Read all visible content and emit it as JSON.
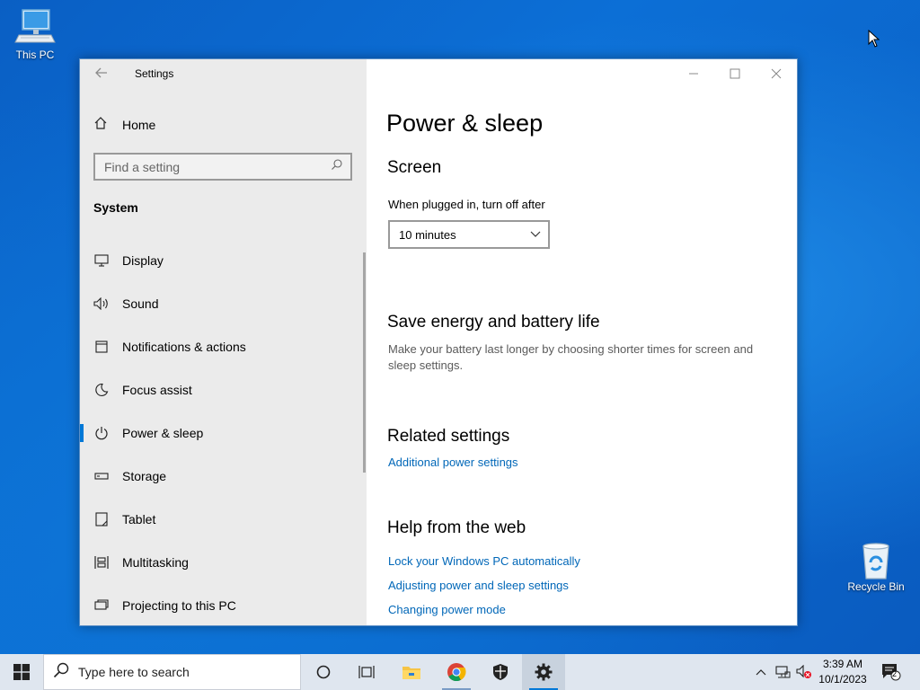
{
  "desktop": {
    "icons": [
      {
        "label": "This PC"
      },
      {
        "label": "Recycle Bin"
      }
    ]
  },
  "window": {
    "title": "Settings",
    "controls": {
      "minimize": "minimize",
      "maximize": "maximize",
      "close": "close"
    }
  },
  "sidebar": {
    "home_label": "Home",
    "search_placeholder": "Find a setting",
    "section_label": "System",
    "items": [
      {
        "label": "Display",
        "icon": "monitor-icon"
      },
      {
        "label": "Sound",
        "icon": "speaker-icon"
      },
      {
        "label": "Notifications & actions",
        "icon": "notifications-icon"
      },
      {
        "label": "Focus assist",
        "icon": "moon-icon"
      },
      {
        "label": "Power & sleep",
        "icon": "power-icon",
        "selected": true
      },
      {
        "label": "Storage",
        "icon": "storage-icon"
      },
      {
        "label": "Tablet",
        "icon": "tablet-icon"
      },
      {
        "label": "Multitasking",
        "icon": "multitasking-icon"
      },
      {
        "label": "Projecting to this PC",
        "icon": "projecting-icon"
      }
    ]
  },
  "main": {
    "page_title": "Power & sleep",
    "screen_heading": "Screen",
    "plugged_label": "When plugged in, turn off after",
    "plugged_value": "10 minutes",
    "save_heading": "Save energy and battery life",
    "save_desc": "Make your battery last longer by choosing shorter times for screen and sleep settings.",
    "related_heading": "Related settings",
    "related_link": "Additional power settings",
    "help_heading": "Help from the web",
    "help_links": [
      "Lock your Windows PC automatically",
      "Adjusting power and sleep settings",
      "Changing power mode"
    ]
  },
  "taskbar": {
    "search_placeholder": "Type here to search",
    "apps": [
      "cortana-icon",
      "task-view-icon",
      "file-explorer-icon",
      "chrome-icon",
      "security-icon",
      "settings-icon"
    ],
    "clock_time": "3:39 AM",
    "clock_date": "10/1/2023",
    "notification_count": "2"
  },
  "colors": {
    "accent": "#0078d7",
    "link": "#0067b8",
    "sidebar_bg": "#ebebeb",
    "taskbar_bg": "#dfe6ef"
  }
}
